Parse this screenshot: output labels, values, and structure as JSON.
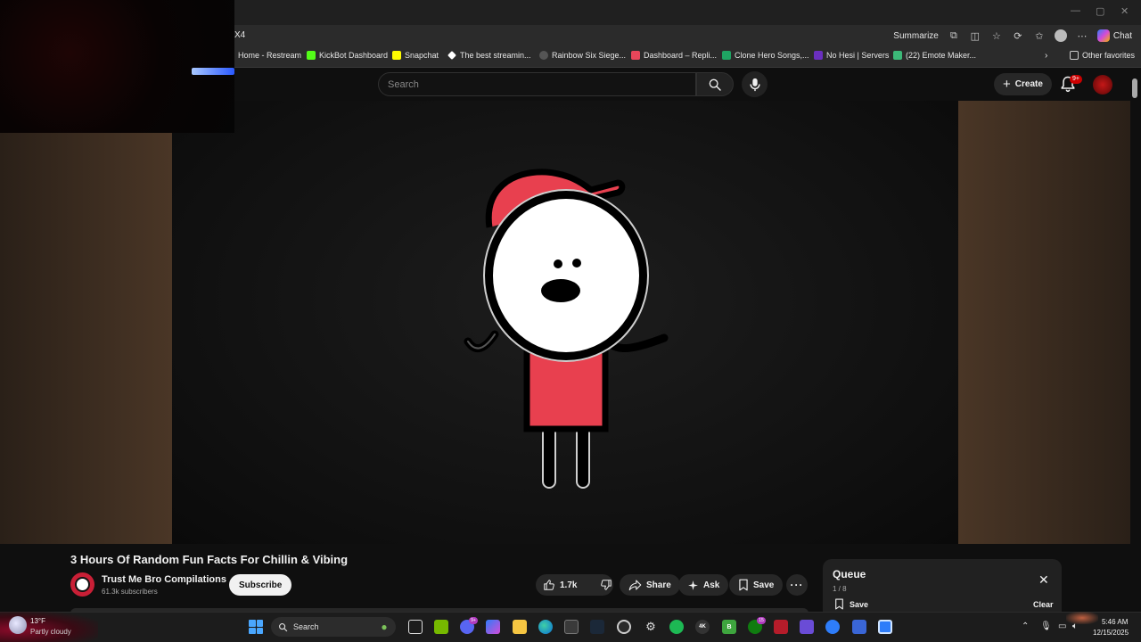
{
  "browser": {
    "url_fragment": "X4",
    "summarize_label": "Summarize",
    "chat_label": "Chat",
    "bookmarks": [
      {
        "label": "Home - Restream",
        "color": "#2e2e2e"
      },
      {
        "label": "KickBot Dashboard",
        "color": "#53fc18"
      },
      {
        "label": "Snapchat",
        "color": "#fffc00"
      },
      {
        "label": "The best streamin...",
        "color": "#ffffff"
      },
      {
        "label": "Rainbow Six Siege...",
        "color": "#3a3a3a"
      },
      {
        "label": "Dashboard – Repli...",
        "color": "#e8465a"
      },
      {
        "label": "Clone Hero Songs,...",
        "color": "#1fa463"
      },
      {
        "label": "No Hesi | Servers",
        "color": "#6a2fbf"
      },
      {
        "label": "(22) Emote Maker...",
        "color": "#3cb878"
      }
    ],
    "other_favorites": "Other favorites"
  },
  "youtube": {
    "search_placeholder": "Search",
    "create_label": "Create",
    "notif_badge": "9+"
  },
  "video": {
    "title": "3 Hours Of Random Fun Facts For Chillin & Vibing",
    "channel_name": "Trust Me Bro Compilations",
    "subscribers": "61.3k subscribers",
    "subscribe_label": "Subscribe",
    "likes": "1.7k",
    "share_label": "Share",
    "ask_label": "Ask",
    "save_label": "Save"
  },
  "queue": {
    "title": "Queue",
    "count": "1 / 8",
    "save_label": "Save",
    "clear_label": "Clear"
  },
  "taskbar": {
    "temperature": "13°F",
    "weather": "Partly cloudy",
    "search_label": "Search",
    "time": "5:46 AM",
    "date": "12/15/2025",
    "badge_discord": "9+",
    "badge_xbox": "15"
  },
  "colors": {
    "accent_red": "#e8404f",
    "background": "#0f0f0f"
  }
}
